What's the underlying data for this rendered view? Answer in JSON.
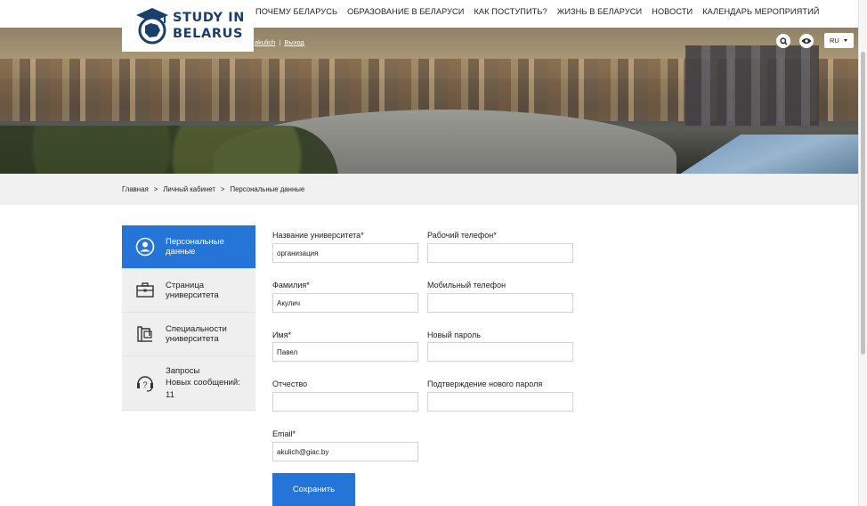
{
  "logo": {
    "line1": "STUDY IN",
    "line2": "BELARUS"
  },
  "nav": {
    "items": [
      "ПОЧЕМУ БЕЛАРУСЬ",
      "ОБРАЗОВАНИЕ В БЕЛАРУСИ",
      "КАК ПОСТУПИТЬ?",
      "ЖИЗНЬ В БЕЛАРУСИ",
      "НОВОСТИ",
      "КАЛЕНДАРЬ МЕРОПРИЯТИЙ"
    ]
  },
  "user": {
    "name": "akulich",
    "logout": "Выход"
  },
  "lang": {
    "current": "RU"
  },
  "icons": {
    "search": "search-icon",
    "eye": "eye-icon",
    "caret": "chevron-down-icon"
  },
  "breadcrumb": [
    "Главная",
    ">",
    "Личный кабинет",
    ">",
    "Персональные данные"
  ],
  "sidebar": {
    "items": [
      {
        "label1": "Персональные",
        "label2": "данные",
        "icon": "user-icon",
        "active": true
      },
      {
        "label1": "Страница",
        "label2": "университета",
        "icon": "briefcase-icon"
      },
      {
        "label1": "Специальности",
        "label2": "университета",
        "icon": "books-icon"
      },
      {
        "label1": "Запросы",
        "label2": "Новых сообщений:",
        "label3": "11",
        "icon": "support-icon"
      }
    ]
  },
  "form": {
    "university": {
      "label": "Название университета*",
      "value": "организация"
    },
    "work_phone": {
      "label": "Рабочий телефон*",
      "value": ""
    },
    "last_name": {
      "label": "Фамилия*",
      "value": "Акулич"
    },
    "mobile_phone": {
      "label": "Мобильный телефон",
      "value": ""
    },
    "first_name": {
      "label": "Имя*",
      "value": "Павел"
    },
    "new_password": {
      "label": "Новый пароль",
      "value": ""
    },
    "patronymic": {
      "label": "Отчество",
      "value": ""
    },
    "confirm_password": {
      "label": "Подтверждение нового пароля",
      "value": ""
    },
    "email": {
      "label": "Email*",
      "value": "akulich@giac.by"
    },
    "save_label": "Сохранить"
  },
  "colors": {
    "accent": "#2575d8",
    "brand": "#1b3f6b",
    "sidebar_bg": "#efefef"
  }
}
